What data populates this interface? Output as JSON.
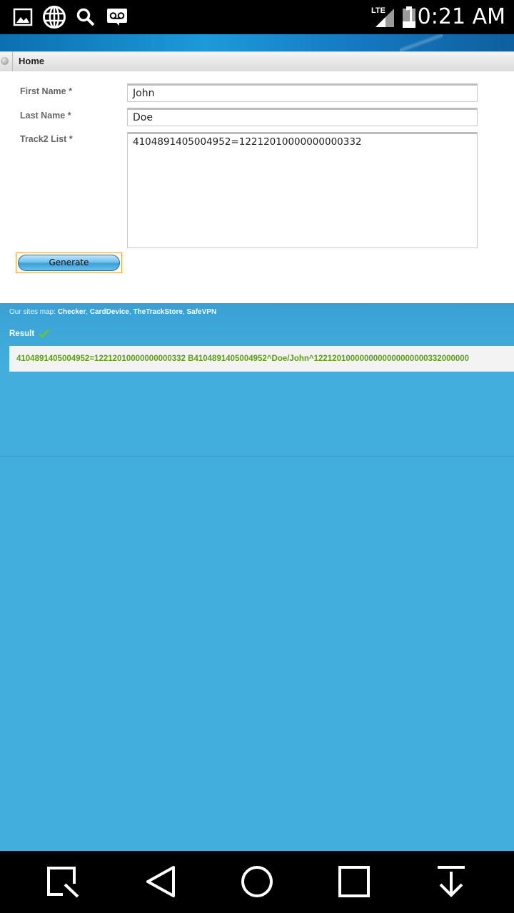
{
  "status_bar": {
    "time": "10:21 AM",
    "network_label": "LTE",
    "icons": [
      "gallery-icon",
      "globe-icon",
      "search-icon",
      "voicemail-icon",
      "lte-signal-icon",
      "battery-icon"
    ]
  },
  "tabbar": {
    "home_label": "Home"
  },
  "form": {
    "first_name_label": "First Name *",
    "first_name_value": "John",
    "last_name_label": "Last Name *",
    "last_name_value": "Doe",
    "track2_label": "Track2 List *",
    "track2_value": "4104891405004952=12212010000000000332",
    "generate_label": "Generate"
  },
  "sites_map": {
    "prefix": "Our sites map: ",
    "links": [
      "Checker",
      "CardDevice",
      "TheTrackStore",
      "SafeVPN"
    ]
  },
  "result": {
    "label": "Result",
    "value": "4104891405004952=12212010000000000332 B4104891405004952^Doe/John^1221201000000000000000000332000000"
  },
  "colors": {
    "result_text": "#5c9d11",
    "page_bg": "#42aedd",
    "button_outline": "#f0a030"
  },
  "nav_bar": {
    "icons": [
      "recents-search-icon",
      "back-icon",
      "home-icon",
      "overview-icon",
      "download-icon"
    ]
  }
}
